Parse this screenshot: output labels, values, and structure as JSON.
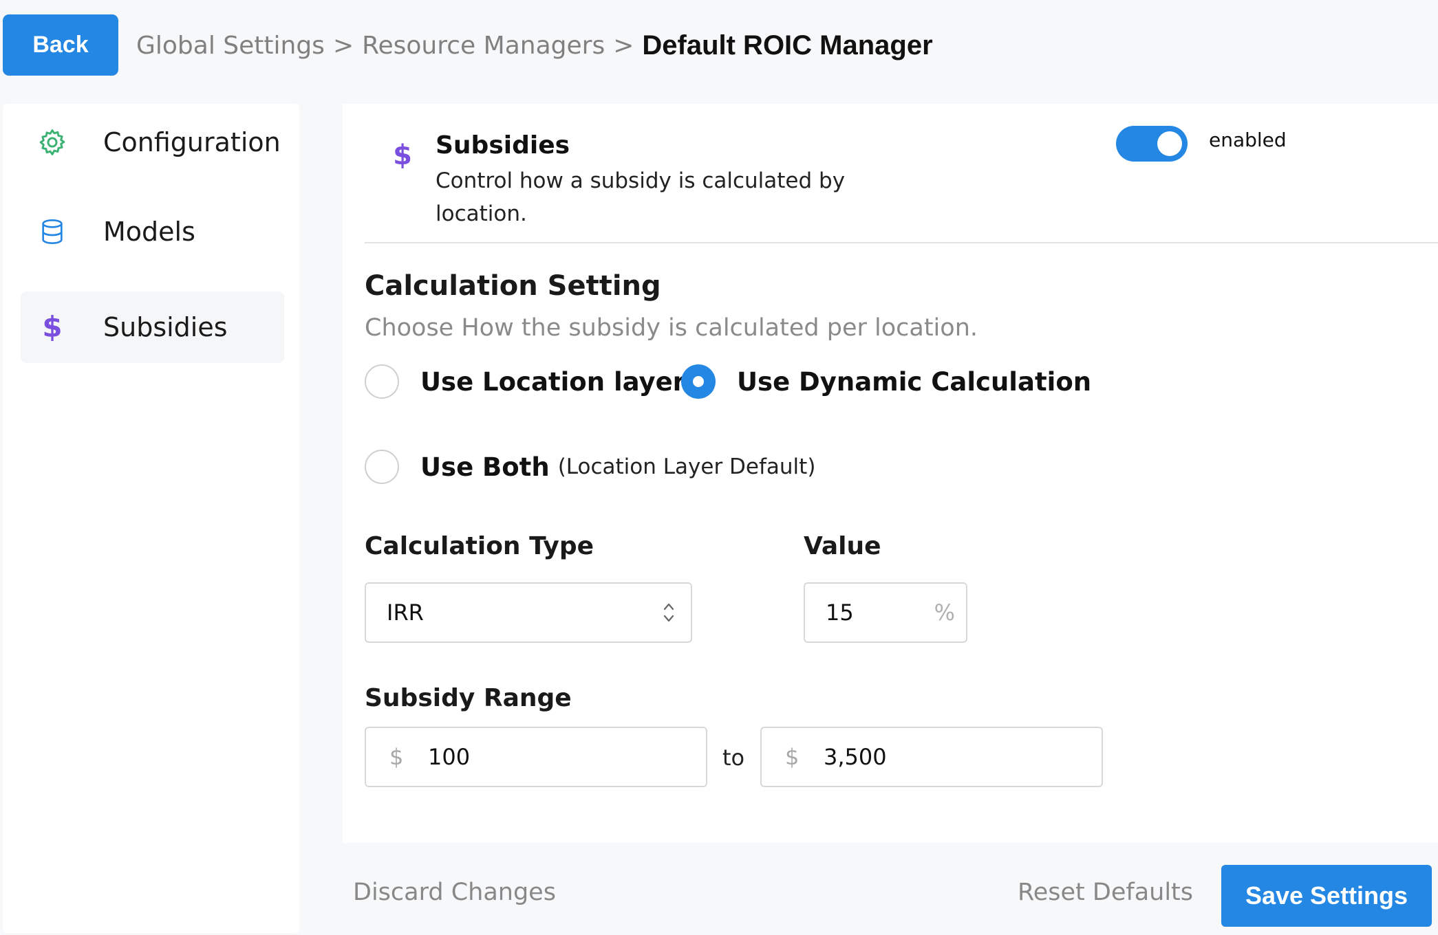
{
  "header": {
    "back_label": "Back",
    "breadcrumb": [
      {
        "label": "Global Settings"
      },
      {
        "label": "Resource Managers"
      },
      {
        "label": "Default ROIC Manager"
      }
    ],
    "separator": ">"
  },
  "sidebar": {
    "items": [
      {
        "label": "Configuration",
        "icon": "gear-icon",
        "active": false,
        "icon_color": "#3bb273"
      },
      {
        "label": "Models",
        "icon": "database-icon",
        "active": false,
        "icon_color": "#2487e4"
      },
      {
        "label": "Subsidies",
        "icon": "dollar-icon",
        "icon_glyph": "$",
        "active": true,
        "icon_color": "#7a4fe0"
      }
    ]
  },
  "section": {
    "icon_glyph": "$",
    "title": "Subsidies",
    "description": "Control how a subsidy is calculated by location.",
    "toggle_state": "enabled",
    "toggle_on": true
  },
  "calculation": {
    "title": "Calculation Setting",
    "subtitle": "Choose How the subsidy is calculated per location.",
    "options": [
      {
        "label": "Use Location layer",
        "note": "",
        "checked": false
      },
      {
        "label": "Use Dynamic Calculation",
        "note": "",
        "checked": true
      },
      {
        "label": "Use Both",
        "note": "(Location Layer Default)",
        "checked": false
      }
    ]
  },
  "calc_type": {
    "label": "Calculation Type",
    "selected": "IRR"
  },
  "value_field": {
    "label": "Value",
    "value": "15",
    "unit": "%"
  },
  "subsidy_range": {
    "label": "Subsidy Range",
    "currency": "$",
    "from": "100",
    "connector": "to",
    "to": "3,500"
  },
  "footer": {
    "discard_label": "Discard Changes",
    "reset_label": "Reset Defaults",
    "save_label": "Save Settings"
  },
  "colors": {
    "accent": "#2487e4",
    "dollar": "#7a4fe0",
    "gear": "#3bb273"
  }
}
